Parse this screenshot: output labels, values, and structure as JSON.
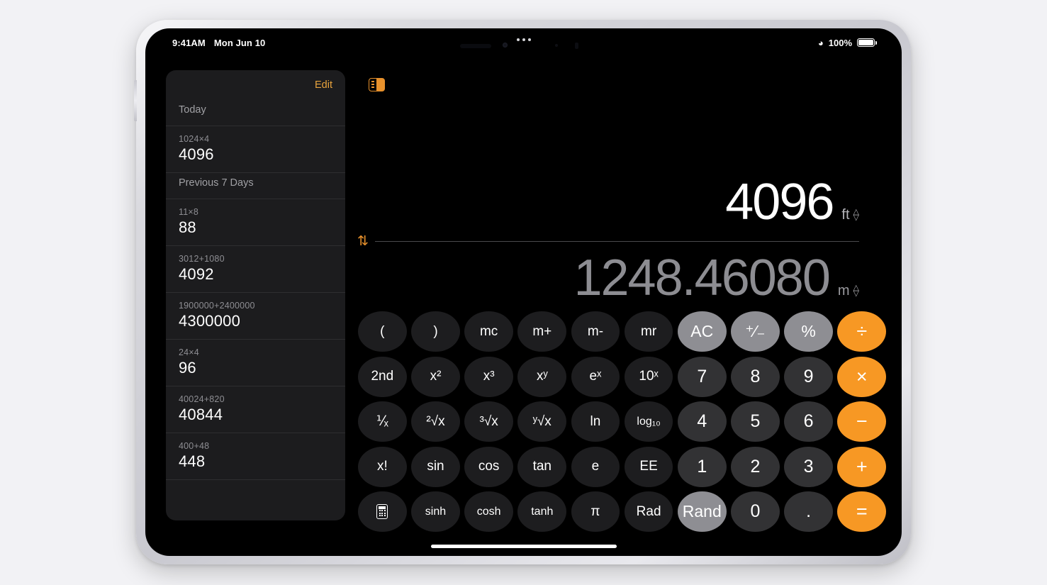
{
  "status_bar": {
    "time": "9:41AM",
    "date": "Mon Jun 10",
    "wifi_icon": "wifi-icon",
    "battery_percent": "100%",
    "multitask_icon": "multitask-dots-icon"
  },
  "sidebar": {
    "edit_label": "Edit",
    "sections": [
      {
        "header": "Today",
        "items": [
          {
            "expression": "1024×4",
            "result": "4096"
          }
        ]
      },
      {
        "header": "Previous 7 Days",
        "items": [
          {
            "expression": "11×8",
            "result": "88"
          },
          {
            "expression": "3012+1080",
            "result": "4092"
          },
          {
            "expression": "1900000+2400000",
            "result": "4300000"
          },
          {
            "expression": "24×4",
            "result": "96"
          },
          {
            "expression": "40024+820",
            "result": "40844"
          },
          {
            "expression": "400+48",
            "result": "448"
          }
        ]
      }
    ]
  },
  "calculator": {
    "sidebar_toggle_icon": "sidebar-toggle-icon",
    "display": {
      "primary_value": "4096",
      "primary_unit": "ft",
      "secondary_value": "1248.46080",
      "secondary_unit": "m",
      "swap_icon": "⇅"
    },
    "keypad": {
      "rows": [
        [
          {
            "label": "(",
            "style": "fn",
            "name": "key-open-paren"
          },
          {
            "label": ")",
            "style": "fn",
            "name": "key-close-paren"
          },
          {
            "label": "mc",
            "style": "fn",
            "name": "key-memory-clear"
          },
          {
            "label": "m+",
            "style": "fn",
            "name": "key-memory-add"
          },
          {
            "label": "m-",
            "style": "fn",
            "name": "key-memory-subtract"
          },
          {
            "label": "mr",
            "style": "fn",
            "name": "key-memory-recall"
          },
          {
            "label": "AC",
            "style": "util",
            "name": "key-all-clear"
          },
          {
            "label": "⁺⁄₋",
            "style": "util",
            "name": "key-sign-toggle"
          },
          {
            "label": "%",
            "style": "util",
            "name": "key-percent"
          },
          {
            "label": "÷",
            "style": "op",
            "name": "key-divide"
          }
        ],
        [
          {
            "label": "2nd",
            "style": "fn",
            "name": "key-second-function"
          },
          {
            "label": "x²",
            "style": "fn",
            "name": "key-x-squared"
          },
          {
            "label": "x³",
            "style": "fn",
            "name": "key-x-cubed"
          },
          {
            "label": "xʸ",
            "style": "fn",
            "name": "key-x-power-y"
          },
          {
            "label": "eˣ",
            "style": "fn",
            "name": "key-e-power-x"
          },
          {
            "label": "10ˣ",
            "style": "fn",
            "name": "key-ten-power-x"
          },
          {
            "label": "7",
            "style": "num",
            "name": "key-7"
          },
          {
            "label": "8",
            "style": "num",
            "name": "key-8"
          },
          {
            "label": "9",
            "style": "num",
            "name": "key-9"
          },
          {
            "label": "×",
            "style": "op",
            "name": "key-multiply"
          }
        ],
        [
          {
            "label": "⅟ₓ",
            "style": "fn",
            "name": "key-reciprocal"
          },
          {
            "label": "²√x",
            "style": "fn",
            "name": "key-square-root"
          },
          {
            "label": "³√x",
            "style": "fn",
            "name": "key-cube-root"
          },
          {
            "label": "ʸ√x",
            "style": "fn",
            "name": "key-y-root"
          },
          {
            "label": "ln",
            "style": "fn",
            "name": "key-natural-log"
          },
          {
            "label": "log₁₀",
            "style": "fn",
            "name": "key-log-base-10"
          },
          {
            "label": "4",
            "style": "num",
            "name": "key-4"
          },
          {
            "label": "5",
            "style": "num",
            "name": "key-5"
          },
          {
            "label": "6",
            "style": "num",
            "name": "key-6"
          },
          {
            "label": "−",
            "style": "op",
            "name": "key-subtract"
          }
        ],
        [
          {
            "label": "x!",
            "style": "fn",
            "name": "key-factorial"
          },
          {
            "label": "sin",
            "style": "fn",
            "name": "key-sin"
          },
          {
            "label": "cos",
            "style": "fn",
            "name": "key-cos"
          },
          {
            "label": "tan",
            "style": "fn",
            "name": "key-tan"
          },
          {
            "label": "e",
            "style": "fn",
            "name": "key-euler"
          },
          {
            "label": "EE",
            "style": "fn",
            "name": "key-exponent"
          },
          {
            "label": "1",
            "style": "num",
            "name": "key-1"
          },
          {
            "label": "2",
            "style": "num",
            "name": "key-2"
          },
          {
            "label": "3",
            "style": "num",
            "name": "key-3"
          },
          {
            "label": "+",
            "style": "op",
            "name": "key-add"
          }
        ],
        [
          {
            "label": "",
            "style": "fn",
            "name": "key-calculator-mode",
            "icon": "calculator-icon"
          },
          {
            "label": "sinh",
            "style": "fn",
            "name": "key-sinh"
          },
          {
            "label": "cosh",
            "style": "fn",
            "name": "key-cosh"
          },
          {
            "label": "tanh",
            "style": "fn",
            "name": "key-tanh"
          },
          {
            "label": "π",
            "style": "fn",
            "name": "key-pi"
          },
          {
            "label": "Rad",
            "style": "fn",
            "name": "key-radian-mode"
          },
          {
            "label": "Rand",
            "style": "util",
            "name": "key-random"
          },
          {
            "label": "0",
            "style": "num",
            "name": "key-0"
          },
          {
            "label": ".",
            "style": "num",
            "name": "key-decimal"
          },
          {
            "label": "=",
            "style": "op",
            "name": "key-equals"
          }
        ]
      ]
    }
  },
  "colors": {
    "accent_orange": "#f79824",
    "edit_orange": "#e8a33d",
    "key_function": "#1d1d1f",
    "key_number": "#323234",
    "key_utility": "#8e8e93",
    "sidebar_bg": "#1c1c1e",
    "screen_bg": "#000000"
  }
}
